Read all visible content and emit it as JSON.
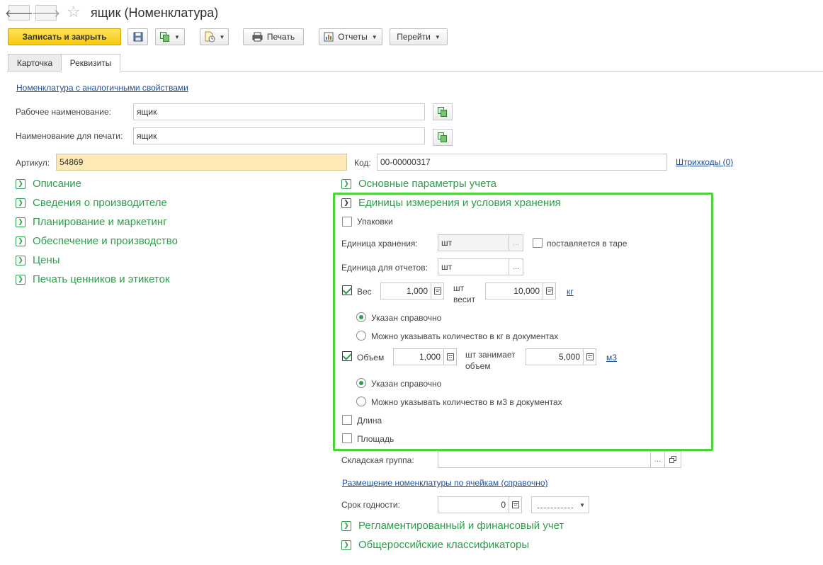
{
  "window": {
    "title": "ящик (Номенклатура)",
    "back_glyph": "🡐",
    "forward_glyph": "🡒",
    "star_glyph": "☆"
  },
  "toolbar": {
    "save_close": "Записать и закрыть",
    "print": "Печать",
    "reports": "Отчеты",
    "goto": "Перейти"
  },
  "tabs": [
    {
      "label": "Карточка",
      "active": false
    },
    {
      "label": "Реквизиты",
      "active": true
    }
  ],
  "form": {
    "similar_link": "Номенклатура с аналогичными свойствами",
    "work_name_label": "Рабочее наименование:",
    "work_name_value": "ящик",
    "print_name_label": "Наименование для печати:",
    "print_name_value": "ящик",
    "article_label": "Артикул:",
    "article_value": "54869",
    "code_label": "Код:",
    "code_value": "00-00000317",
    "barcodes_link": "Штрихкоды (0)"
  },
  "left_groups": [
    "Описание",
    "Сведения о производителе",
    "Планирование и маркетинг",
    "Обеспечение и производство",
    "Цены",
    "Печать ценников и этикеток"
  ],
  "right": {
    "basic_params": "Основные параметры учета",
    "units_group": "Единицы измерения и условия хранения",
    "packages_label": "Упаковки",
    "packages_checked": false,
    "storage_unit_label": "Единица хранения:",
    "storage_unit_value": "шт",
    "supplied_in_tare_label": "поставляется в таре",
    "supplied_in_tare_checked": false,
    "report_unit_label": "Единица для отчетов:",
    "report_unit_value": "шт",
    "weight": {
      "label": "Вес",
      "checked": true,
      "qty": "1,000",
      "mid_text_1": "шт",
      "mid_text_2": "весит",
      "amount": "10,000",
      "unit_link": "кг",
      "radio_1": "Указан справочно",
      "radio_2": "Можно указывать количество в кг в документах",
      "selected": 1
    },
    "volume": {
      "label": "Объем",
      "checked": true,
      "qty": "1,000",
      "mid_text_1": "шт занимает",
      "mid_text_2": "объем",
      "amount": "5,000",
      "unit_link": "м3",
      "radio_1": "Указан справочно",
      "radio_2": "Можно указывать количество в м3 в документах",
      "selected": 1
    },
    "length_label": "Длина",
    "length_checked": false,
    "area_label": "Площадь",
    "area_checked": false,
    "warehouse_group_label": "Складская группа:",
    "warehouse_group_value": "",
    "cells_link": "Размещение номенклатуры по ячейкам (справочно)",
    "shelf_life_label": "Срок годности:",
    "shelf_life_value": "0",
    "regulated_group": "Регламентированный и финансовый учет",
    "classifiers_group": "Общероссийские классификаторы"
  },
  "colors": {
    "group_green": "#2e9d4c",
    "highlight_green": "#4fd33a",
    "link_blue": "#1f4e9a",
    "primary_yellow": "#f6c90e",
    "article_bg": "#fce9b5"
  }
}
